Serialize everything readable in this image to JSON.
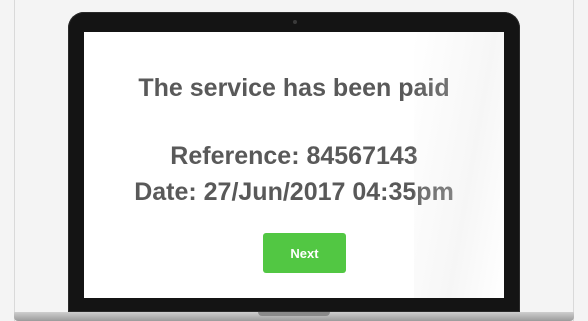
{
  "screen": {
    "title": "The service has been paid",
    "reference": "Reference: 84567143",
    "date": "Date: 27/Jun/2017 04:35pm",
    "next_label": "Next"
  },
  "colors": {
    "text": "#595959",
    "button": "#52c743",
    "button_text": "#ffffff",
    "bezel": "#141414"
  }
}
